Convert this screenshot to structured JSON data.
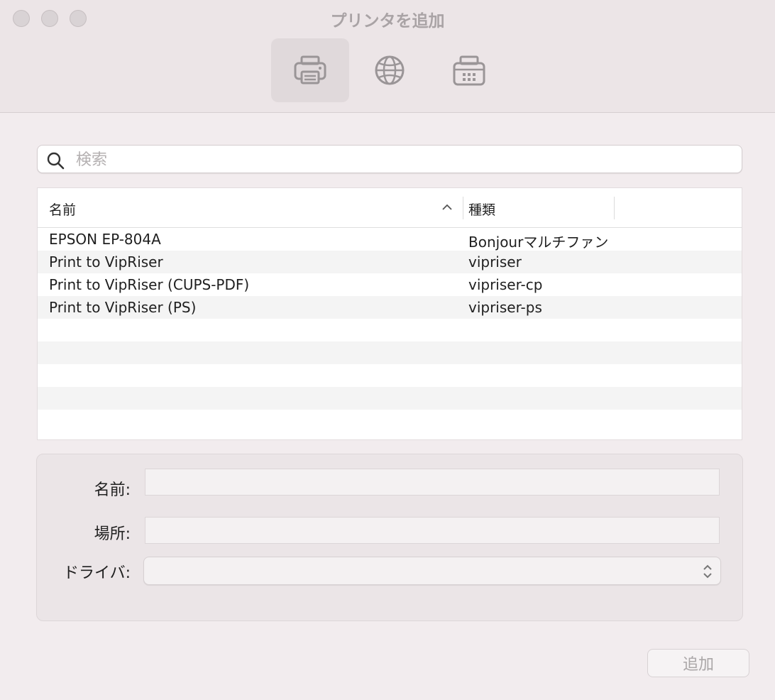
{
  "window": {
    "title": "プリンタを追加"
  },
  "toolbar": {
    "items": [
      {
        "icon": "printer-icon",
        "selected": true
      },
      {
        "icon": "globe-icon",
        "selected": false
      },
      {
        "icon": "printer-fax-icon",
        "selected": false
      }
    ]
  },
  "search": {
    "placeholder": "検索",
    "value": ""
  },
  "table": {
    "columns": [
      "名前",
      "種類"
    ],
    "sort_indicator": "^",
    "rows": [
      {
        "name": "EPSON EP-804A",
        "kind": "Bonjourマルチファンクション"
      },
      {
        "name": "Print to VipRiser",
        "kind": "vipriser"
      },
      {
        "name": "Print to VipRiser (CUPS-PDF)",
        "kind": "vipriser-cp"
      },
      {
        "name": "Print to VipRiser (PS)",
        "kind": "vipriser-ps"
      }
    ]
  },
  "details": {
    "name_label": "名前:",
    "location_label": "場所:",
    "driver_label": "ドライバ:",
    "name_value": "",
    "location_value": "",
    "driver_value": ""
  },
  "actions": {
    "add_label": "追加"
  },
  "colors": {
    "window_bg": "#f2ecee",
    "selected_tool_bg": "#e0d9db",
    "disabled_text": "#aaa6a7"
  }
}
